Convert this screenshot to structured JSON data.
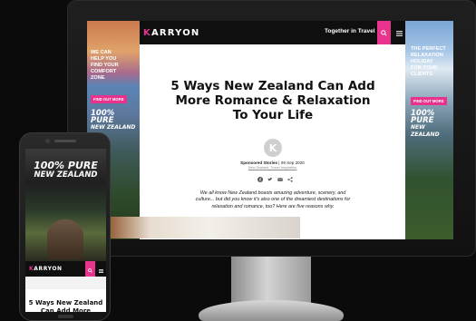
{
  "desktop": {
    "header": {
      "logo_k": "K",
      "logo_rest": "ARRYON",
      "tagline": "Together in Travel"
    },
    "left_ad": {
      "headline_lines": [
        "WE CAN",
        "HELP YOU",
        "FIND YOUR",
        "COMFORT",
        "ZONE"
      ],
      "button": "FIND OUT MORE",
      "brand_line1": "100% PURE",
      "brand_line2": "NEW ZEALAND"
    },
    "right_ad": {
      "headline_lines": [
        "THE PERFECT",
        "RELAXATION",
        "HOLIDAY",
        "FOR YOUR",
        "CLIENTS"
      ],
      "button": "FIND OUT MORE",
      "brand_line1": "100% PURE",
      "brand_line2": "NEW ZEALAND"
    },
    "article": {
      "title": "5 Ways New Zealand Can Add More Romance & Relaxation To Your Life",
      "author_initial": "K",
      "byline_label": "Sponsored Stories",
      "byline_date": "09 Sep 2020",
      "categories": "New Zealand, Travel Inspiration",
      "intro": "We all know New Zealand boasts amazing adventure, scenery, and culture... but did you know it's also one of the dreamiest destinations for relaxation and romance, too? Here are five reasons why."
    }
  },
  "phone": {
    "ad_brand_line1": "100% PURE",
    "ad_brand_line2": "NEW ZEALAND",
    "logo_k": "K",
    "logo_rest": "ARRYON",
    "headline": "5 Ways New Zealand Can Add More"
  },
  "colors": {
    "brand_pink": "#e8338d",
    "header_black": "#0f0f0f"
  },
  "icons": [
    "search-icon",
    "menu-icon",
    "facebook-icon",
    "twitter-icon",
    "email-icon",
    "share-icon"
  ]
}
